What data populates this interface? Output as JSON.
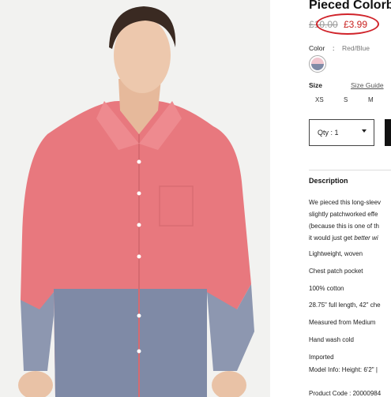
{
  "product": {
    "title": "Pieced Colorbl",
    "old_price": "£10.00",
    "new_price": "£3.99"
  },
  "color": {
    "label": "Color",
    "separator": ":",
    "value": "Red/Blue",
    "swatch_colors": [
      "#f0c6cf",
      "#7f8aa6"
    ]
  },
  "size": {
    "label": "Size",
    "guide_link": "Size Guide",
    "options": [
      "XS",
      "S",
      "M"
    ]
  },
  "quantity": {
    "label": "Qty : 1"
  },
  "description": {
    "heading": "Description",
    "paragraph": [
      "We pieced this long-sleev",
      "slightly patchworked effe",
      "(because this is one of th"
    ],
    "paragraph_last_plain": "it would just get ",
    "paragraph_last_italic": "better wi",
    "features": [
      "Lightweight, woven",
      "Chest patch pocket",
      "100% cotton",
      "28.75\" full length, 42\" che",
      "Measured from Medium",
      "Hand wash cold",
      "Imported",
      "Model Info: Height: 6'2\" |",
      "Product Code : 20000984"
    ]
  },
  "colors": {
    "sale_red": "#c8201e",
    "highlight_circle": "#d0232a",
    "shirt_pink": "#e8787e",
    "shirt_blue": "#7f8aa6"
  }
}
